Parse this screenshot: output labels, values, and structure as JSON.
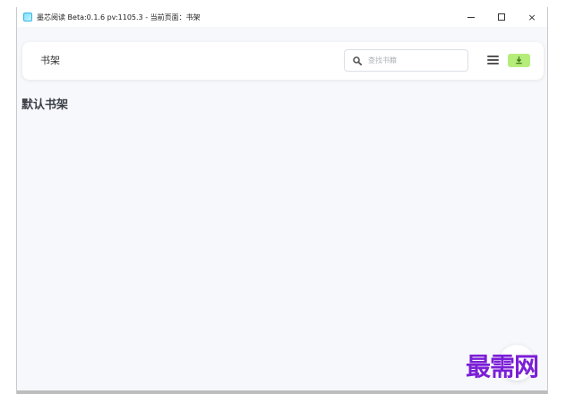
{
  "window": {
    "title": "墨芯阅读 Beta:0.1.6 pv:1105.3 - 当前页面：书架",
    "controls": {
      "minimize": "−",
      "maximize": "□",
      "close": "×"
    }
  },
  "navbar": {
    "title": "书架",
    "search": {
      "placeholder": "查找书籍",
      "value": ""
    }
  },
  "main": {
    "section_title": "默认书架"
  },
  "watermark": {
    "text": "最需网"
  },
  "colors": {
    "download_button": "#b6ec7a",
    "watermark": "#7b1fd6",
    "background": "#f6f8fb"
  },
  "icons": [
    "app-icon",
    "search-icon",
    "menu-icon",
    "download-icon"
  ]
}
